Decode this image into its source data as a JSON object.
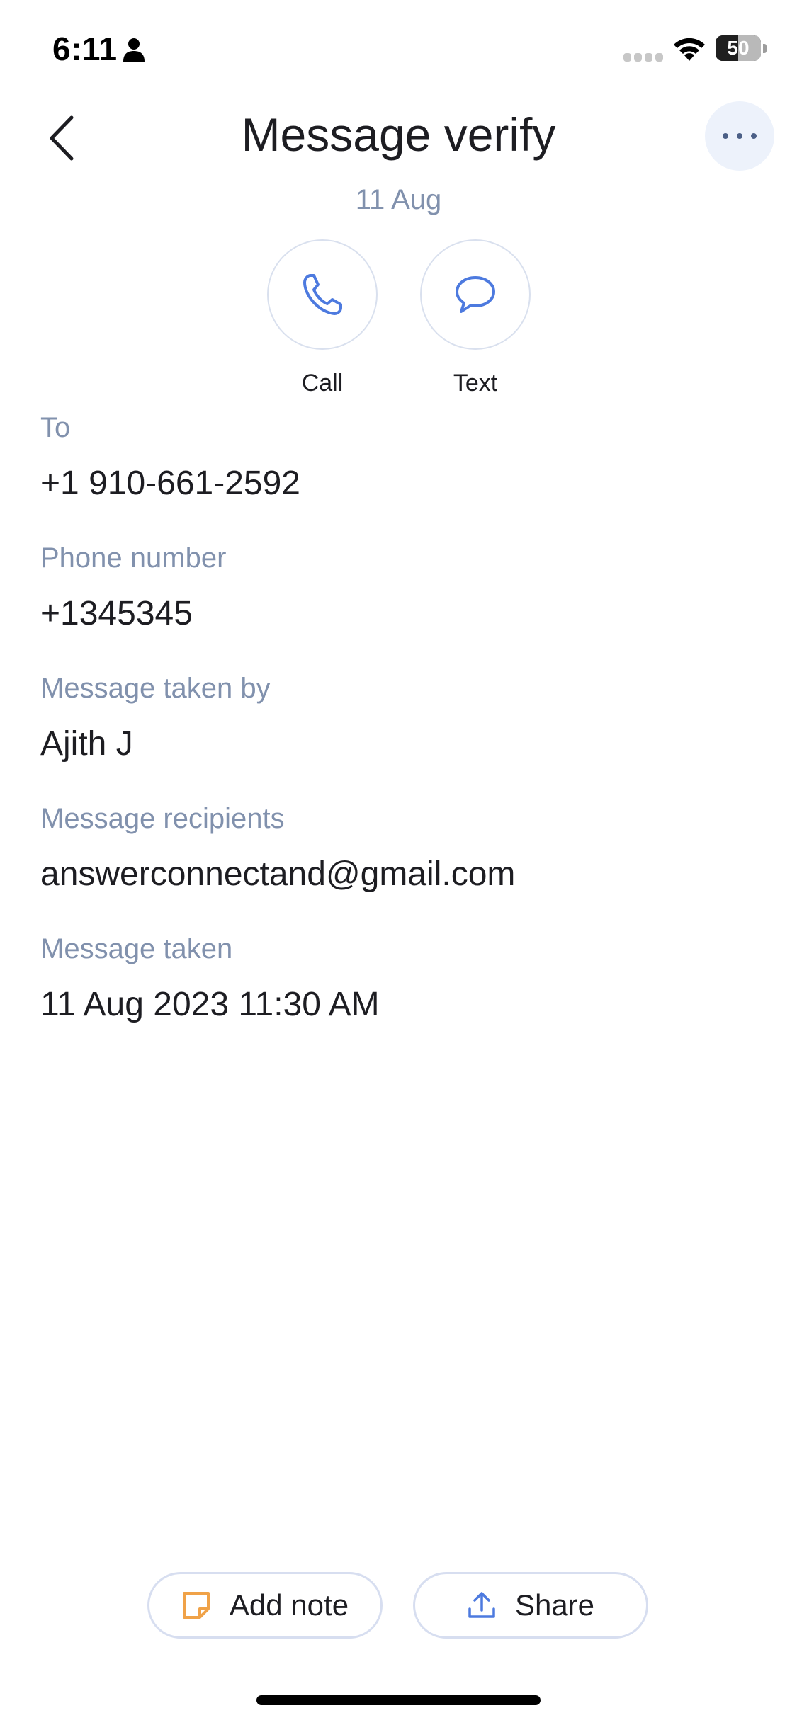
{
  "status_bar": {
    "time": "6:11",
    "battery_level": "50",
    "battery_fraction": 0.5,
    "icons": [
      "person-icon",
      "cellular-signal-icon",
      "wifi-icon",
      "battery-icon"
    ]
  },
  "header": {
    "title": "Message verify",
    "date": "11 Aug",
    "back_icon": "chevron-left-icon",
    "more_icon": "ellipsis-icon"
  },
  "actions": [
    {
      "label": "Call",
      "icon": "phone-icon"
    },
    {
      "label": "Text",
      "icon": "chat-bubble-icon"
    }
  ],
  "fields": [
    {
      "label": "To",
      "value": "+1 910-661-2592"
    },
    {
      "label": "Phone number",
      "value": "+1345345"
    },
    {
      "label": "Message taken by",
      "value": "Ajith J"
    },
    {
      "label": "Message recipients",
      "value": "answerconnectand@gmail.com"
    },
    {
      "label": "Message taken",
      "value": "11 Aug 2023 11:30 AM"
    }
  ],
  "bottom_actions": {
    "add_note": {
      "label": "Add note",
      "icon": "note-icon"
    },
    "share": {
      "label": "Share",
      "icon": "upload-icon"
    }
  },
  "colors": {
    "accent": "#4d7adf",
    "muted_text": "#8191ad",
    "note_icon": "#f0a248",
    "border": "#d7def0"
  }
}
